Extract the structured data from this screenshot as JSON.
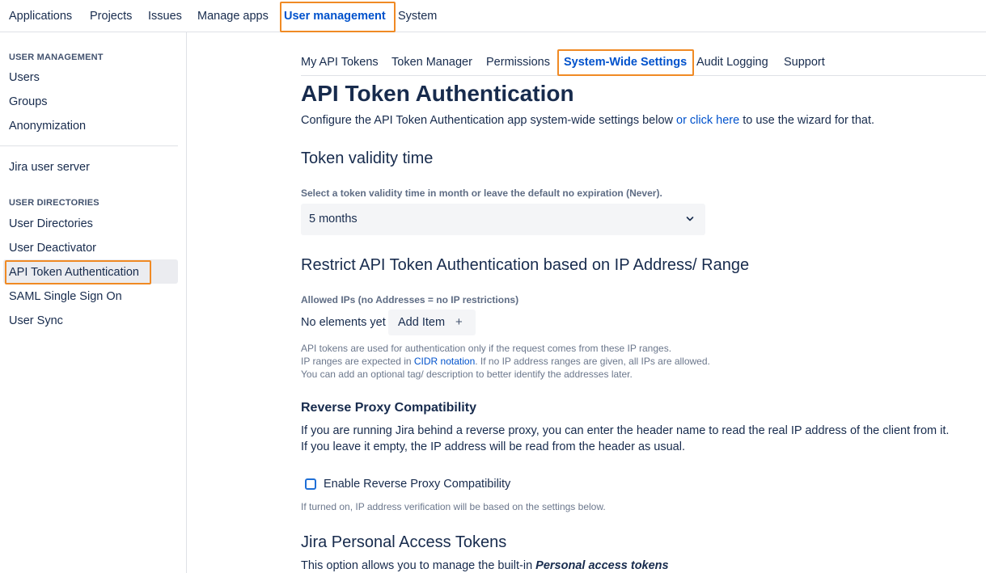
{
  "topnav": {
    "items": [
      "Applications",
      "Projects",
      "Issues",
      "Manage apps",
      "User management",
      "System"
    ],
    "active": "User management"
  },
  "sidebar": {
    "section1_heading": "USER MANAGEMENT",
    "section1_items": [
      "Users",
      "Groups",
      "Anonymization"
    ],
    "standalone_item": "Jira user server",
    "section2_heading": "USER DIRECTORIES",
    "section2_items": [
      "User Directories",
      "User Deactivator",
      "API Token Authentication",
      "SAML Single Sign On",
      "User Sync"
    ],
    "active": "API Token Authentication"
  },
  "tabs": {
    "items": [
      "My API Tokens",
      "Token Manager",
      "Permissions",
      "System-Wide Settings",
      "Audit Logging",
      "Support"
    ],
    "active": "System-Wide Settings"
  },
  "page": {
    "title": "API Token Authentication",
    "intro_before": "Configure the API Token Authentication app system-wide settings below ",
    "intro_link": "or click here",
    "intro_after": " to use the wizard for that."
  },
  "validity": {
    "heading": "Token validity time",
    "label": "Select a token validity time in month or leave the default no expiration (Never).",
    "selected": "5 months"
  },
  "ip_restrict": {
    "heading": "Restrict API Token Authentication based on IP Address/ Range",
    "label": "Allowed IPs (no Addresses = no IP restrictions)",
    "empty_text": "No elements yet",
    "add_button": "Add Item",
    "add_icon": "+",
    "help_line1": "API tokens are used for authentication only if the request comes from these IP ranges.",
    "help_line2_before": "IP ranges are expected in ",
    "help_line2_link": "CIDR notation",
    "help_line2_after": ". If no IP address ranges are given, all IPs are allowed.",
    "help_line3": "You can add an optional tag/ description to better identify the addresses later."
  },
  "reverse_proxy": {
    "heading": "Reverse Proxy Compatibility",
    "desc_line1": "If you are running Jira behind a reverse proxy, you can enter the header name to read the real IP address of the client from it.",
    "desc_line2": "If you leave it empty, the IP address will be read from the header as usual.",
    "checkbox_label": "Enable Reverse Proxy Compatibility",
    "checked": false,
    "help": "If turned on, IP address verification will be based on the settings below."
  },
  "pat": {
    "heading": "Jira Personal Access Tokens",
    "desc_before": "This option allows you to manage the built-in ",
    "desc_emph": "Personal access tokens"
  },
  "colors": {
    "highlight": "#f08a24",
    "link": "#0052cc",
    "text": "#172b4d"
  }
}
